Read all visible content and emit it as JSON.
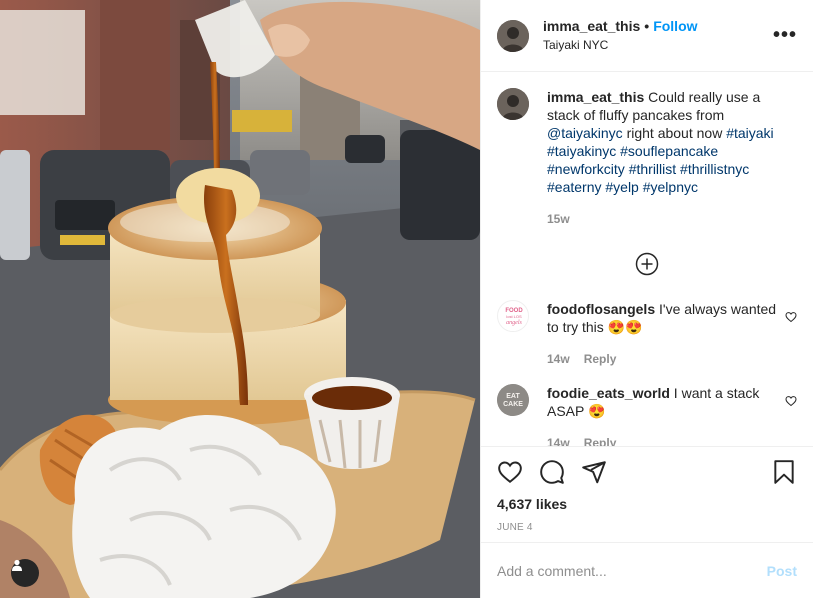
{
  "post": {
    "username": "imma_eat_this",
    "follow_label": "Follow",
    "dot": "•",
    "location": "Taiyaki NYC",
    "more_label": "•••"
  },
  "caption": {
    "username": "imma_eat_this",
    "text_1": " Could really use a stack of fluffy pancakes from ",
    "mention": "@taiyakinyc",
    "text_2": " right about now ",
    "hashtags": "#taiyaki #taiyakinyc #souflepancake #newforkcity #thrillist #thrillistnyc #eaterny #yelp #yelpnyc",
    "time": "15w"
  },
  "comments": [
    {
      "username": "foodoflosangels",
      "text": " I've always wanted to try this 😍😍",
      "time": "14w",
      "reply_label": "Reply",
      "avatar_text": "FOOD lost LOS angels"
    },
    {
      "username": "foodie_eats_world",
      "text": " I want a stack ASAP 😍",
      "time": "14w",
      "reply_label": "Reply",
      "avatar_text": "EAT CAKE"
    }
  ],
  "stats": {
    "likes": "4,637 likes",
    "date": "JUNE 4"
  },
  "composer": {
    "placeholder": "Add a comment...",
    "post_label": "Post"
  },
  "colors": {
    "accent": "#0095f6",
    "hashtag": "#00376b",
    "muted": "#8e8e8e",
    "post_disabled": "#b2dffc"
  },
  "icons": [
    "user-tag-icon",
    "more-icon",
    "load-more-icon",
    "heart-icon",
    "comment-icon",
    "share-icon",
    "save-icon",
    "comment-heart-icon"
  ]
}
